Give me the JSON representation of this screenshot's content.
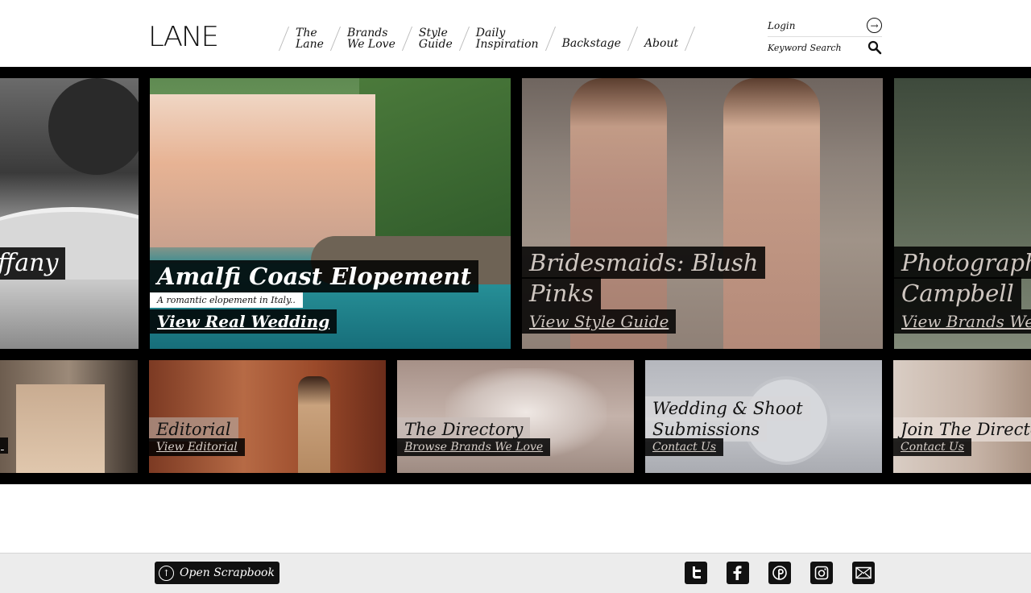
{
  "header": {
    "logo": "LANE",
    "nav": [
      {
        "label": "The\nLane"
      },
      {
        "label": "Brands\nWe Love"
      },
      {
        "label": "Style\nGuide"
      },
      {
        "label": "Daily\nInspiration"
      },
      {
        "label": "Backstage"
      },
      {
        "label": "About"
      }
    ],
    "login_label": "Login",
    "search_placeholder": "Keyword Search"
  },
  "features": {
    "left_partial": {
      "title": "ffany"
    },
    "amalfi": {
      "title": "Amalfi Coast Elopement",
      "subtitle": "A romantic elopement in Italy..",
      "link": "View Real Wedding"
    },
    "bridesmaids": {
      "title_line1": "Bridesmaids: Blush",
      "title_line2": "Pinks",
      "link": "View Style Guide"
    },
    "right_partial": {
      "title_line1": "Photograph",
      "title_line2": "Campbell",
      "link": "View Brands We L"
    }
  },
  "bottom_tiles": {
    "editorial": {
      "title": "Editorial",
      "link": "View Editorial"
    },
    "directory": {
      "title": "The Directory",
      "link": "Browse Brands We Love"
    },
    "submissions": {
      "title_line1": "Wedding & Shoot",
      "title_line2": "Submissions",
      "link": "Contact Us"
    },
    "join": {
      "title": "Join The Directory",
      "link": "Contact Us"
    }
  },
  "footer": {
    "scrapbook_label": "Open Scrapbook",
    "social": [
      "twitter-icon",
      "facebook-icon",
      "pinterest-icon",
      "instagram-icon",
      "email-icon"
    ]
  }
}
